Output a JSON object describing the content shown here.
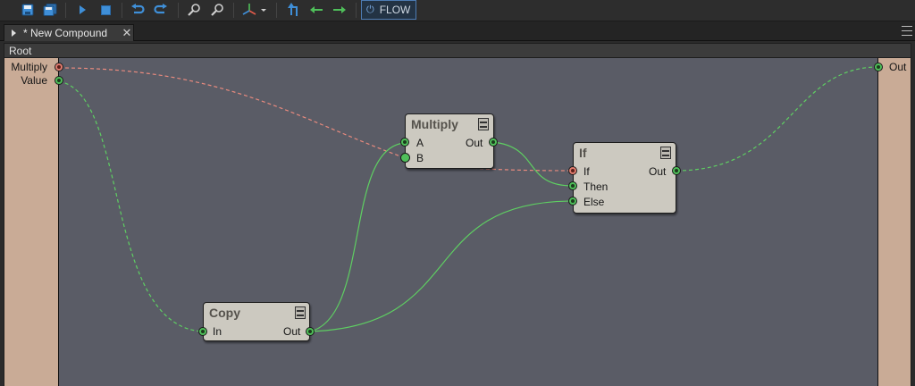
{
  "toolbar": {
    "buttons": [
      {
        "name": "save-icon"
      },
      {
        "name": "save-all-icon"
      },
      {
        "name": "run-icon"
      },
      {
        "name": "stop-icon"
      },
      {
        "name": "undo-icon"
      },
      {
        "name": "redo-icon"
      },
      {
        "name": "zoom-in-icon"
      },
      {
        "name": "zoom-out-icon"
      },
      {
        "name": "axis-icon"
      },
      {
        "name": "up-level-icon"
      },
      {
        "name": "back-arrow-icon"
      },
      {
        "name": "forward-arrow-icon"
      }
    ],
    "flow_label": "FLOW"
  },
  "tab": {
    "title": "* New Compound"
  },
  "breadcrumb": {
    "root": "Root"
  },
  "graph": {
    "inputs": [
      {
        "label": "Multiply",
        "port_color": "red"
      },
      {
        "label": "Value",
        "port_color": "green"
      }
    ],
    "outputs": [
      {
        "label": "Out",
        "port_color": "green"
      }
    ],
    "nodes": {
      "multiply": {
        "title": "Multiply",
        "inputs": [
          "A",
          "B"
        ],
        "output": "Out"
      },
      "if": {
        "title": "If",
        "inputs": [
          "If",
          "Then",
          "Else"
        ],
        "output": "Out"
      },
      "copy": {
        "title": "Copy",
        "input": "In",
        "output": "Out"
      }
    }
  },
  "colors": {
    "canvas": "#5a5c66",
    "rail": "#c9ab96",
    "node": "#ccc9c0",
    "wire_green": "#5ecf62",
    "wire_red": "#e88a7e",
    "accent": "#4d7bb3"
  }
}
